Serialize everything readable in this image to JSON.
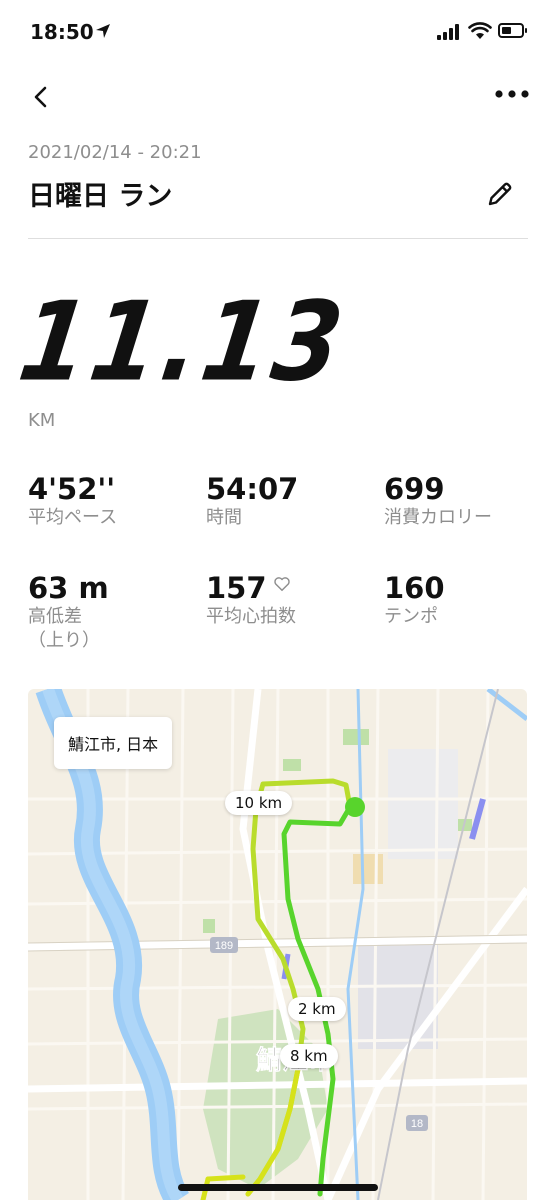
{
  "status_bar": {
    "time": "18:50"
  },
  "activity": {
    "datetime": "2021/02/14 - 20:21",
    "title": "日曜日 ラン",
    "distance": "11.13",
    "distance_unit": "KM"
  },
  "stats": [
    {
      "value": "4'52''",
      "label": "平均ペース"
    },
    {
      "value": "54:07",
      "label": "時間"
    },
    {
      "value": "699",
      "label": "消費カロリー"
    },
    {
      "value": "63 m",
      "label": "高低差\n（上り）"
    },
    {
      "value": "157",
      "label": "平均心拍数"
    },
    {
      "value": "160",
      "label": "テンポ"
    }
  ],
  "map": {
    "location_label": "鯖江市, 日本",
    "km_markers": [
      "10 km",
      "2 km",
      "8 km"
    ],
    "city_name": "鯖江市",
    "road_numbers": [
      "189",
      "18"
    ]
  },
  "colors": {
    "route_start": "#58d42c",
    "route_end": "#d6e21b",
    "river": "#9ecdf6",
    "rail": "#8a8ff0"
  }
}
